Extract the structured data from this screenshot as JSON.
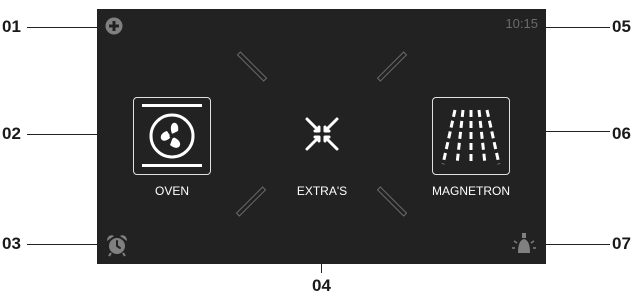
{
  "callouts": {
    "c01": "01",
    "c02": "02",
    "c03": "03",
    "c04": "04",
    "c05": "05",
    "c06": "06",
    "c07": "07"
  },
  "screen": {
    "time": "10:15",
    "oven_label": "OVEN",
    "extras_label": "EXTRA'S",
    "magnetron_label": "MAGNETRON"
  },
  "icons": {
    "top_left": "plus-circle-icon",
    "bottom_left": "alarm-clock-icon",
    "bottom_right": "light-bulb-icon",
    "oven": "fan-icon",
    "extras": "cross-arrows-icon",
    "magnetron": "microwave-waves-icon"
  },
  "colors": {
    "screen_bg": "#222222",
    "icon_grey": "#808080",
    "text_white": "#ffffff"
  }
}
